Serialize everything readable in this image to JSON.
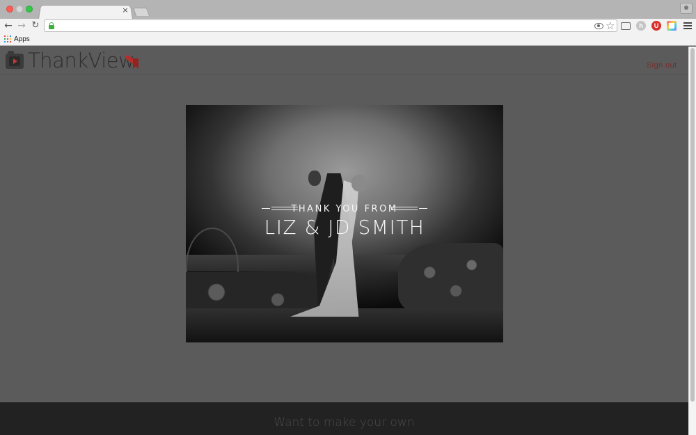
{
  "browser": {
    "tab_close": "×",
    "bookmarks": {
      "apps_label": "Apps"
    },
    "nav": {
      "back": "←",
      "forward": "→",
      "reload": "↻"
    },
    "extensions": {
      "honey": "h",
      "ublock": "U"
    },
    "star": "☆"
  },
  "site": {
    "brand": "ThankView",
    "header": {
      "signout_label": "Sign out"
    },
    "video": {
      "kicker": "Thank You From",
      "names": "Liz & JD Smith"
    },
    "footer": {
      "cta": "Want to make your own"
    }
  },
  "colors": {
    "page_bg": "#5b5b5b",
    "accent": "#7a2c2a",
    "brand_red": "#b52f2a",
    "footer_bg": "#222222"
  }
}
